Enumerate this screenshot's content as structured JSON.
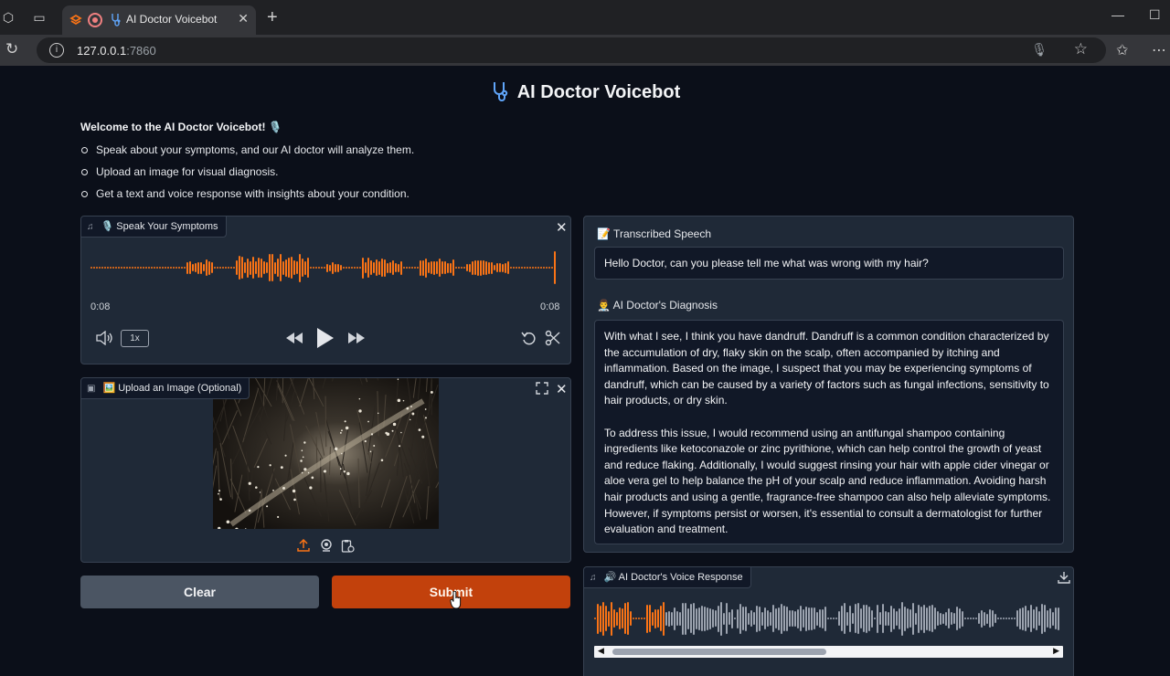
{
  "browser": {
    "tab_title": "AI Doctor Voicebot",
    "url_host": "127.0.0.1",
    "url_port": ":7860"
  },
  "app": {
    "title": "AI Doctor Voicebot",
    "welcome": "Welcome to the AI Doctor Voicebot! 🎙️",
    "bullets": [
      "Speak about your symptoms, and our AI doctor will analyze them.",
      "Upload an image for visual diagnosis.",
      "Get a text and voice response with insights about your condition."
    ]
  },
  "audio_input": {
    "label": "🎙️ Speak Your Symptoms",
    "time_current": "0:08",
    "time_total": "0:08",
    "playback_rate": "1x",
    "progress": 1.0
  },
  "image_input": {
    "label": "🖼️ Upload an Image (Optional)"
  },
  "buttons": {
    "clear": "Clear",
    "submit": "Submit"
  },
  "transcription": {
    "title": "📝 Transcribed Speech",
    "text": "Hello Doctor, can you please tell me what was wrong with my hair?"
  },
  "diagnosis": {
    "title": "👨‍⚕️ AI Doctor's Diagnosis",
    "paragraph1": "With what I see, I think you have dandruff. Dandruff is a common condition characterized by the accumulation of dry, flaky skin on the scalp, often accompanied by itching and inflammation. Based on the image, I suspect that you may be experiencing symptoms of dandruff, which can be caused by a variety of factors such as fungal infections, sensitivity to hair products, or dry skin.",
    "paragraph2": "To address this issue, I would recommend using an antifungal shampoo containing ingredients like ketoconazole or zinc pyrithione, which can help control the growth of yeast and reduce flaking. Additionally, I would suggest rinsing your hair with apple cider vinegar or aloe vera gel to help balance the pH of your scalp and reduce inflammation. Avoiding harsh hair products and using a gentle, fragrance-free shampoo can also help alleviate symptoms. However, if symptoms persist or worsen, it's essential to consult a dermatologist for further evaluation and treatment."
  },
  "voice_response": {
    "label": "🔊 AI Doctor's Voice Response",
    "progress": 0.15
  },
  "colors": {
    "accent": "#f97316",
    "background": "#0b0f19",
    "panel": "#1f2937",
    "submit": "#c2410c",
    "clear": "#4b5563"
  }
}
